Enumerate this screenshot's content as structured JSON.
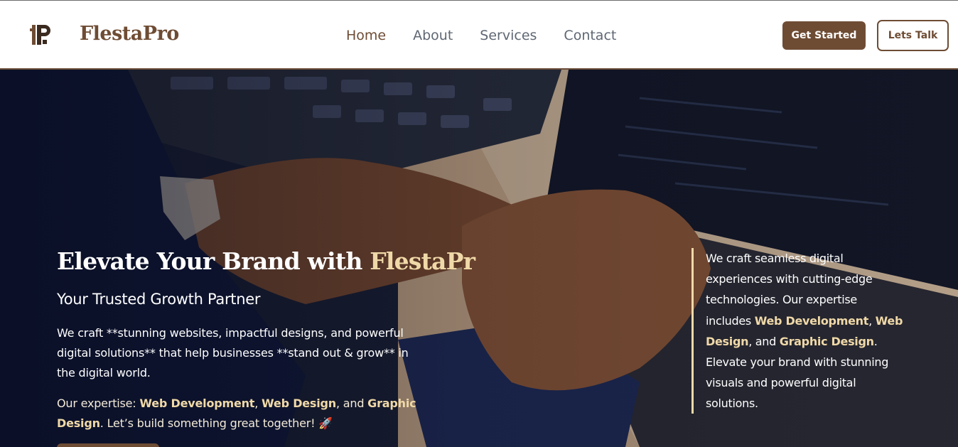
{
  "header": {
    "logo_icon": "fp-monogram-icon",
    "brand_name": "FlestaPro",
    "nav": [
      {
        "label": "Home",
        "active": true
      },
      {
        "label": "About",
        "active": false
      },
      {
        "label": "Services",
        "active": false
      },
      {
        "label": "Contact",
        "active": false
      }
    ],
    "cta_primary": "Get Started",
    "cta_secondary": "Lets Talk"
  },
  "hero": {
    "title_prefix": "Elevate Your Brand with ",
    "title_brand": "FlestaPr",
    "subtitle": "Your Trusted Growth Partner",
    "description": "We craft **stunning websites, impactful designs, and powerful digital solutions** that help businesses **stand out & grow** in the digital world.",
    "expertise": {
      "prefix": "Our expertise: ",
      "item1": "Web Development",
      "sep1": ", ",
      "item2": "Web Design",
      "sep2": ", and ",
      "item3": "Graphic Design",
      "suffix": ". Let’s build something great together! 🚀"
    },
    "side_panel": {
      "text1": "We craft seamless digital experiences with cutting-edge technologies. Our expertise includes ",
      "item1": "Web Development",
      "sep1": ", ",
      "item2": "Web Design",
      "sep2": ", and ",
      "item3": "Graphic Design",
      "text2": ". Elevate your brand with stunning visuals and powerful digital solutions."
    }
  },
  "colors": {
    "brand": "#6e4c34",
    "accent": "#f0d9a8",
    "nav_text": "#5f6773"
  }
}
